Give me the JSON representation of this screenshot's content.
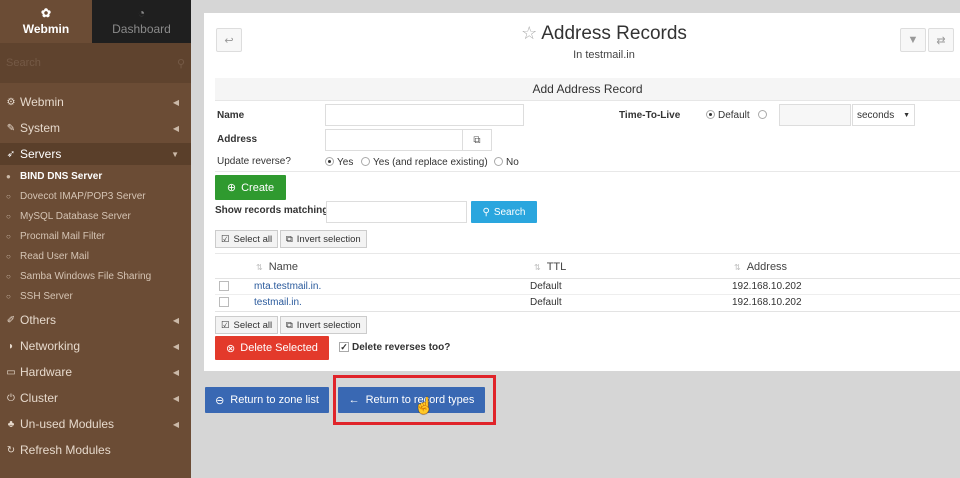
{
  "sidebar": {
    "tab_webmin": "Webmin",
    "tab_dashboard": "Dashboard",
    "search_placeholder": "Search",
    "items": [
      {
        "label": "Webmin",
        "icon": "gear-icon"
      },
      {
        "label": "System",
        "icon": "wrench-icon"
      },
      {
        "label": "Servers",
        "icon": "rocket-icon"
      },
      {
        "label": "Others",
        "icon": "pencil-icon"
      },
      {
        "label": "Networking",
        "icon": "shield-icon"
      },
      {
        "label": "Hardware",
        "icon": "hard-drive-icon"
      },
      {
        "label": "Cluster",
        "icon": "power-icon"
      },
      {
        "label": "Un-used Modules",
        "icon": "puzzle-icon"
      },
      {
        "label": "Refresh Modules",
        "icon": "refresh-icon"
      }
    ],
    "server_subitems": [
      "BIND DNS Server",
      "Dovecot IMAP/POP3 Server",
      "MySQL Database Server",
      "Procmail Mail Filter",
      "Read User Mail",
      "Samba Windows File Sharing",
      "SSH Server"
    ]
  },
  "header": {
    "title": "Address Records",
    "subtitle": "In testmail.in"
  },
  "form": {
    "heading": "Add Address Record",
    "name_label": "Name",
    "ttl_label": "Time-To-Live",
    "ttl_default": "Default",
    "ttl_unit": "seconds",
    "address_label": "Address",
    "update_reverse_label": "Update reverse?",
    "opt_yes": "Yes",
    "opt_yes_replace": "Yes (and replace existing)",
    "opt_no": "No",
    "create_label": "Create"
  },
  "filter": {
    "label": "Show records matching:",
    "search_label": "Search"
  },
  "selection": {
    "select_all": "Select all",
    "invert": "Invert selection"
  },
  "table": {
    "columns": [
      "Name",
      "TTL",
      "Address"
    ],
    "rows": [
      {
        "name": "mta.testmail.in.",
        "ttl": "Default",
        "address": "192.168.10.202"
      },
      {
        "name": "testmail.in.",
        "ttl": "Default",
        "address": "192.168.10.202"
      }
    ]
  },
  "actions": {
    "delete_selected": "Delete Selected",
    "delete_reverses": "Delete reverses too?",
    "return_zone": "Return to zone list",
    "return_types": "Return to record types"
  },
  "colors": {
    "sidebar_bg": "#6b4c35",
    "green": "#2f9a2f",
    "blue": "#3968b3",
    "red": "#e33a2b",
    "search_blue": "#2aa6de",
    "highlight": "#e0242a"
  }
}
